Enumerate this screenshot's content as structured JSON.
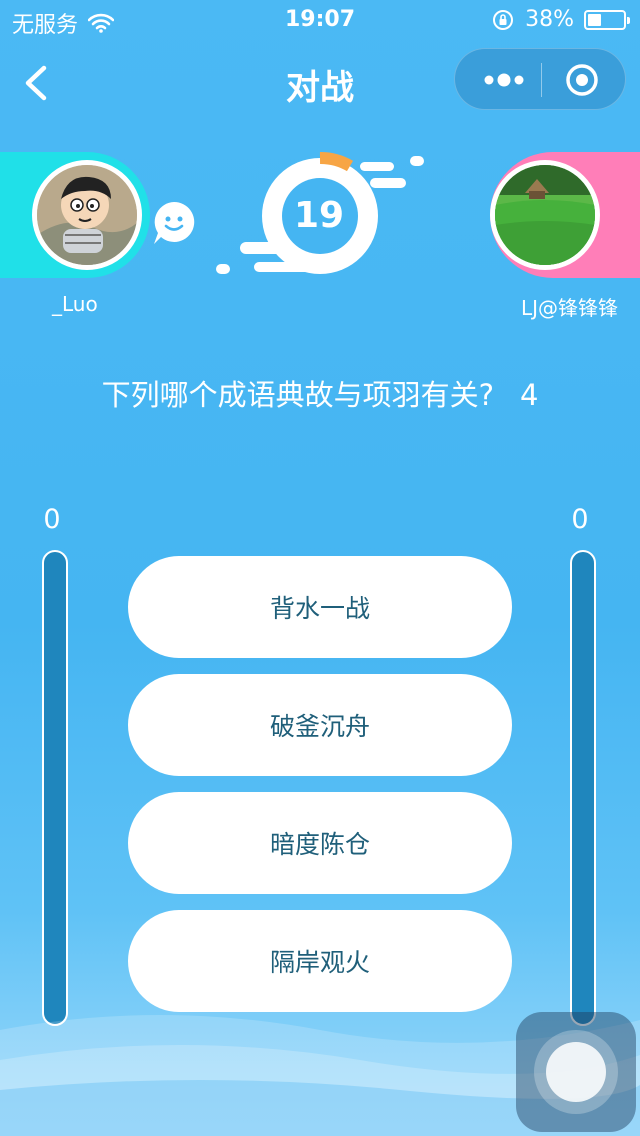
{
  "status_bar": {
    "carrier": "无服务",
    "time": "19:07",
    "battery_percent": "38%",
    "battery_level": 0.38,
    "icons": [
      "wifi-icon",
      "rotation-lock-icon",
      "battery-icon"
    ]
  },
  "nav": {
    "title": "对战",
    "icons": [
      "back-icon",
      "more-icon",
      "close-target-icon"
    ]
  },
  "players": {
    "left": {
      "name": "_Luo",
      "band_color": "#20e0e8"
    },
    "right": {
      "name": "LJ@锋锋锋",
      "band_color": "#ff7eb8"
    }
  },
  "timer": {
    "value": "19",
    "accent": "#f7a545"
  },
  "question": {
    "text": "下列哪个成语典故与项羽有关?",
    "number": "4"
  },
  "scores": {
    "left": "0",
    "right": "0",
    "left_fill": 0,
    "right_fill": 0
  },
  "options": [
    "背水一战",
    "破釜沉舟",
    "暗度陈仓",
    "隔岸观火"
  ],
  "colors": {
    "background": "#45b5f2",
    "bar": "#1f86bd",
    "option_text": "#1f5f7a"
  }
}
